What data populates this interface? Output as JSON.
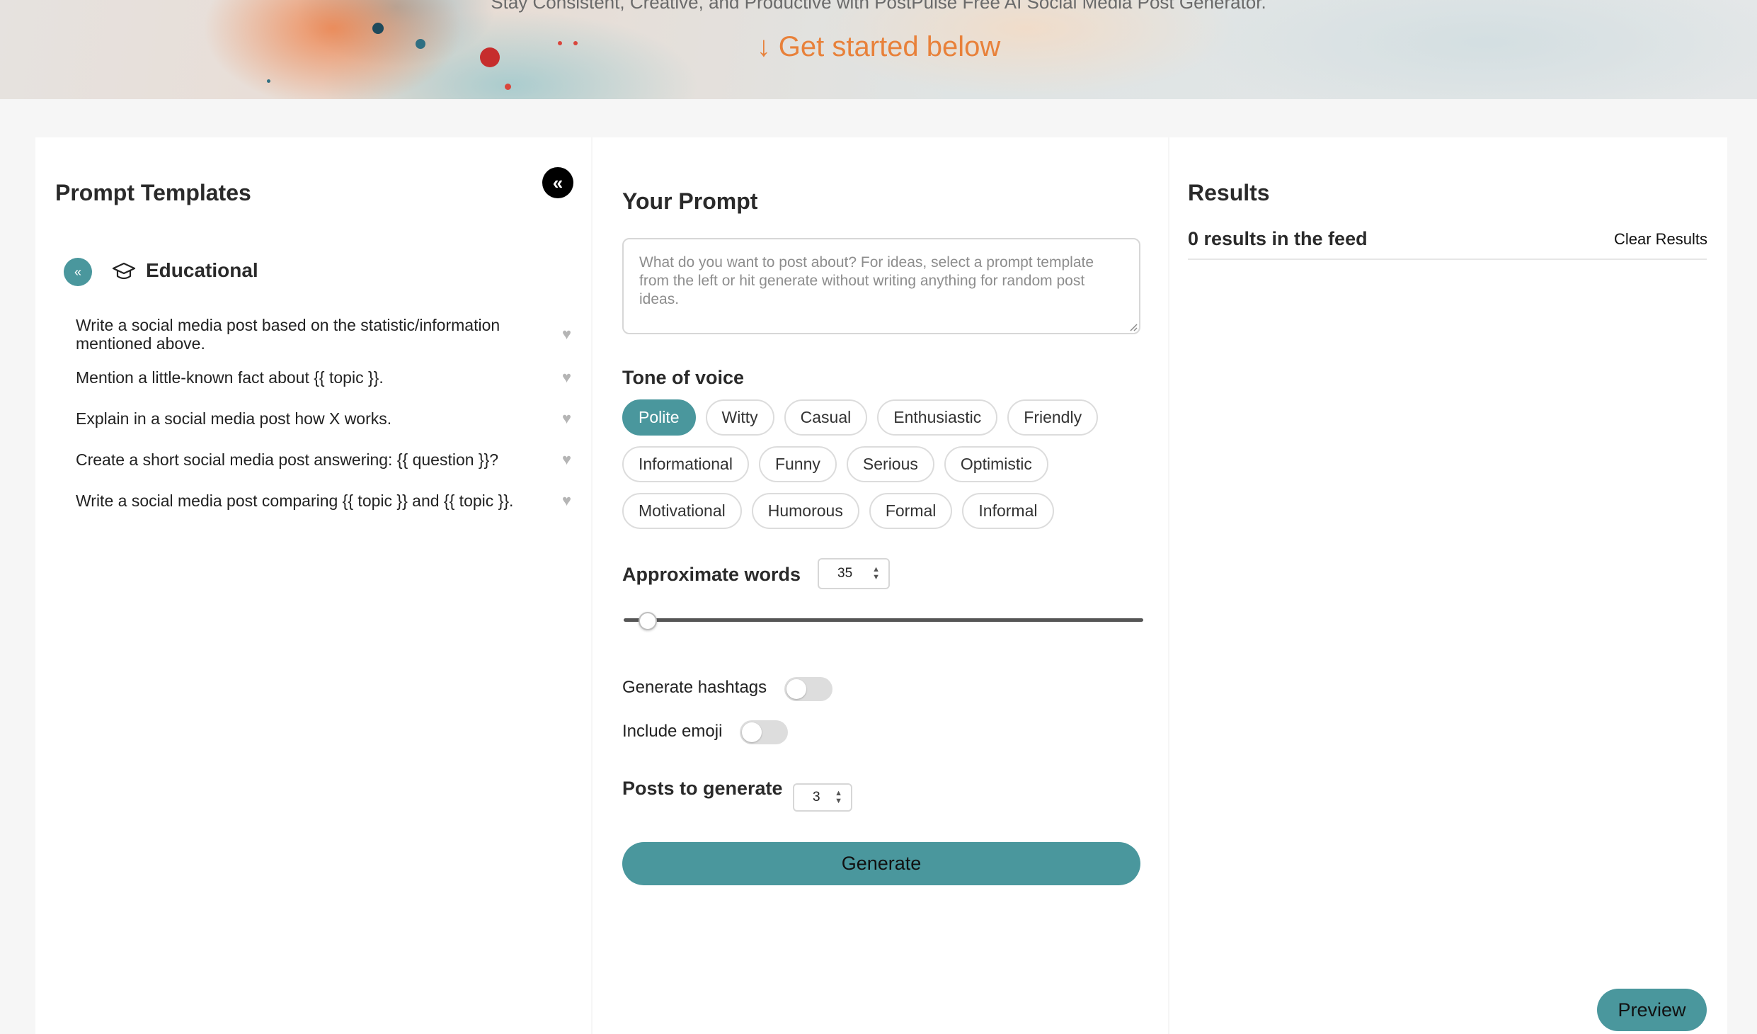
{
  "hero": {
    "tagline": "Stay Consistent, Creative, and Productive with PostPulse Free AI Social Media Post Generator.",
    "cta": "↓ Get started below"
  },
  "templates": {
    "title": "Prompt Templates",
    "collapse_label": "«",
    "category_toggle_label": "«",
    "category": "Educational",
    "items": [
      "Write a social media post based on the statistic/information mentioned above.",
      "Mention a little-known fact about {{ topic }}.",
      "Explain in a social media post how X works.",
      "Create a short social media post answering: {{ question }}?",
      "Write a social media post comparing {{ topic }} and {{ topic }}."
    ],
    "favorite_glyph": "♥"
  },
  "prompt": {
    "title": "Your Prompt",
    "placeholder": "What do you want to post about? For ideas, select a prompt template from the left or hit generate without writing anything for random post ideas.",
    "value": ""
  },
  "tone": {
    "label": "Tone of voice",
    "selected": "Polite",
    "rows": [
      [
        "Polite",
        "Witty",
        "Casual",
        "Enthusiastic",
        "Friendly"
      ],
      [
        "Informational",
        "Funny",
        "Serious",
        "Optimistic"
      ],
      [
        "Motivational",
        "Humorous",
        "Formal",
        "Informal"
      ]
    ]
  },
  "words": {
    "label": "Approximate words",
    "value": "35",
    "slider_fraction": 0.03
  },
  "options": {
    "hashtags_label": "Generate hashtags",
    "hashtags_on": false,
    "emoji_label": "Include emoji",
    "emoji_on": false
  },
  "posts": {
    "label": "Posts to generate",
    "value": "3"
  },
  "generate_label": "Generate",
  "results": {
    "title": "Results",
    "count_text": "0 results in the feed",
    "clear_label": "Clear Results"
  },
  "preview_label": "Preview",
  "colors": {
    "accent": "#4a979d",
    "cta_orange": "#e8813a"
  }
}
